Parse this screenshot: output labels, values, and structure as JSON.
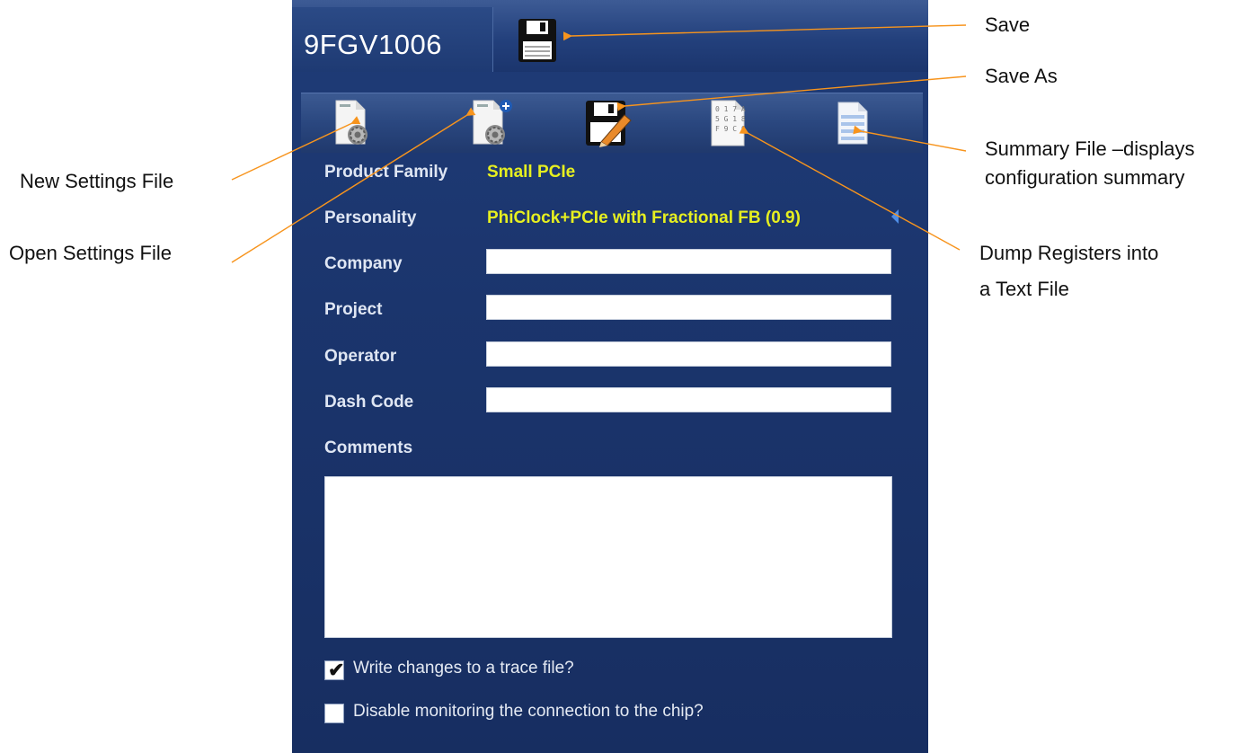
{
  "window": {
    "part_title": "9FGV1006"
  },
  "toolbar": {
    "buttons": [
      {
        "name": "new-settings-file",
        "icon": "new-settings-file-icon"
      },
      {
        "name": "open-settings-file",
        "icon": "open-settings-file-icon"
      },
      {
        "name": "save-as",
        "icon": "save-as-icon"
      },
      {
        "name": "dump-registers",
        "icon": "dump-registers-icon"
      },
      {
        "name": "summary-file",
        "icon": "summary-file-icon"
      }
    ]
  },
  "form": {
    "product_family_label": "Product Family",
    "product_family_value": "Small PCIe",
    "personality_label": "Personality",
    "personality_value": "PhiClock+PCIe with Fractional FB (0.9)",
    "company_label": "Company",
    "company_value": "",
    "project_label": "Project",
    "project_value": "",
    "operator_label": "Operator",
    "operator_value": "",
    "dash_code_label": "Dash Code",
    "dash_code_value": "",
    "comments_label": "Comments",
    "comments_value": ""
  },
  "options": {
    "trace_file_label": "Write changes to a trace file?",
    "trace_file_checked": true,
    "disable_monitoring_label": "Disable monitoring the connection to the chip?",
    "disable_monitoring_checked": false
  },
  "annotations": {
    "save": "Save",
    "save_as": "Save As",
    "summary_line1": "Summary File –displays",
    "summary_line2": "configuration summary",
    "new_settings": "New Settings File",
    "open_settings": "Open Settings File",
    "dump_line1": "Dump Registers into",
    "dump_line2": "a Text File"
  },
  "colors": {
    "panel_background": "#1b356d",
    "value_text": "#e6ef20",
    "annotation_line": "#f7941d"
  }
}
